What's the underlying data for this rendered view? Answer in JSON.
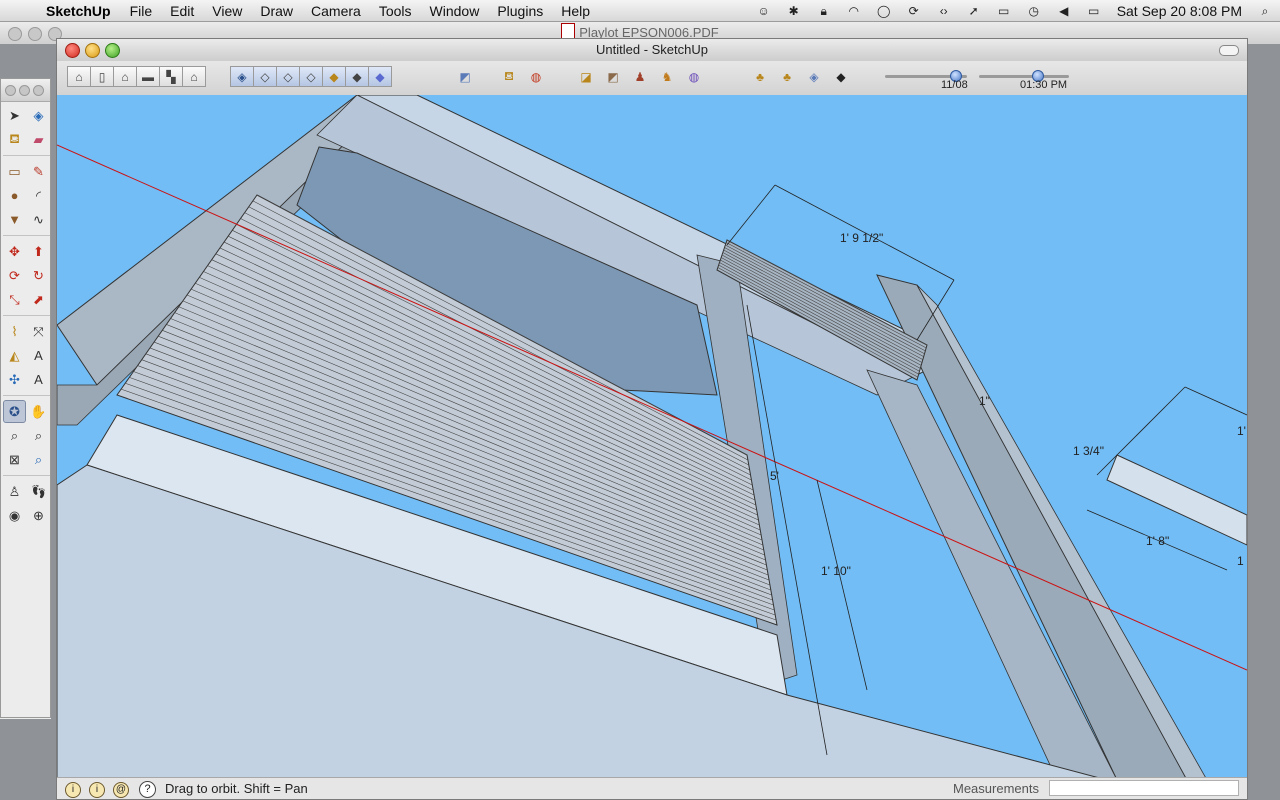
{
  "menubar": {
    "app_name": "SketchUp",
    "items": [
      "File",
      "Edit",
      "View",
      "Draw",
      "Camera",
      "Tools",
      "Window",
      "Plugins",
      "Help"
    ],
    "status_icons": [
      "accessibility-icon",
      "bluetooth-icon",
      "lock-icon",
      "wifi-icon",
      "chat-icon",
      "sync-icon",
      "code-icon",
      "location-icon",
      "display-icon",
      "time-machine-icon",
      "volume-icon",
      "battery-icon"
    ],
    "clock": "Sat Sep 20  8:08 PM"
  },
  "background_window": {
    "title": "Playlot EPSON006.PDF"
  },
  "sketchup": {
    "title": "Untitled - SketchUp",
    "shadow_settings": {
      "date": "11/08",
      "time": "01:30 PM",
      "date_level_fraction": 0.85,
      "time_level_fraction": 0.62
    },
    "status_message": "Drag to orbit.  Shift = Pan",
    "measurements_label": "Measurements",
    "measurements_value": ""
  },
  "dimensions": {
    "d1": "1' 9 1/2\"",
    "d2": "1' 10\"",
    "d3": "5'",
    "d4": "1\"",
    "d5": "1 3/4\"",
    "d6": "1' 8\"",
    "d7": "1",
    "d8": "1'"
  },
  "colors": {
    "sky": "#72bdf5",
    "axis_red": "#cc1111",
    "structure_fill": "#c9d4e0"
  }
}
